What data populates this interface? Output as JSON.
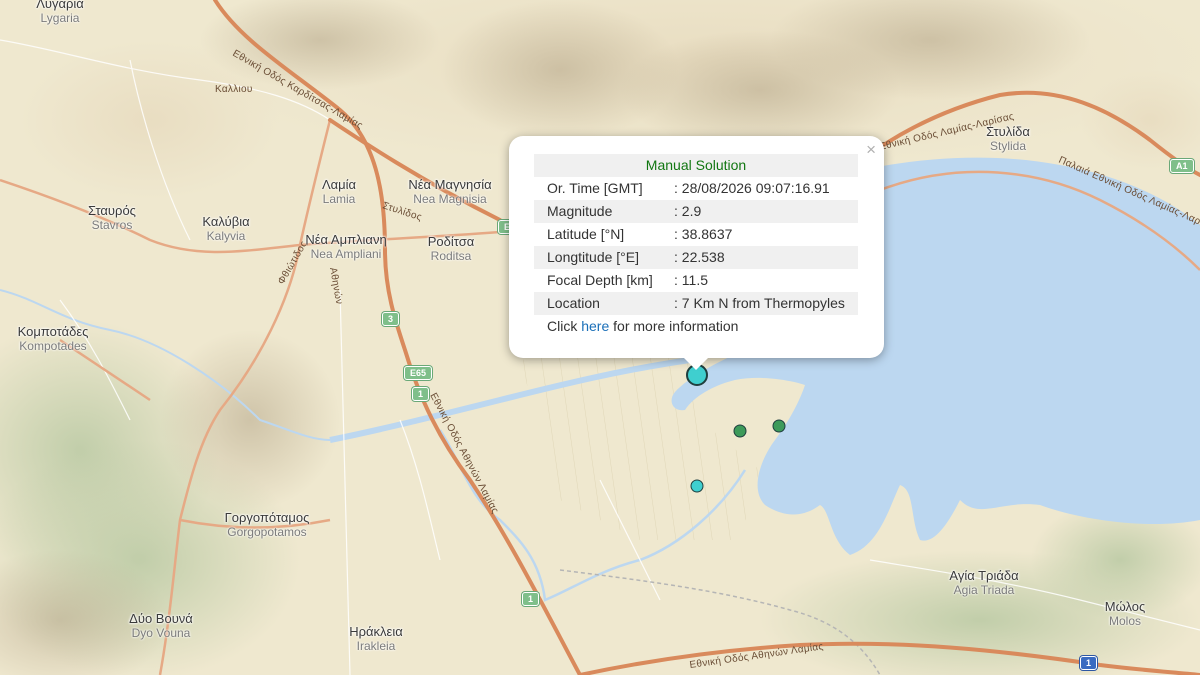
{
  "places": [
    {
      "id": "lygaria",
      "gr": "Λυγαριά",
      "lat": "Lygaria"
    },
    {
      "id": "stylida",
      "gr": "Στυλίδα",
      "lat": "Stylida"
    },
    {
      "id": "lamia",
      "gr": "Λαμία",
      "lat": "Lamia"
    },
    {
      "id": "nea-magnisia",
      "gr": "Νέα Μαγνησία",
      "lat": "Nea Magnisia"
    },
    {
      "id": "stavros",
      "gr": "Σταυρός",
      "lat": "Stavros"
    },
    {
      "id": "kalyvia",
      "gr": "Καλύβια",
      "lat": "Kalyvia"
    },
    {
      "id": "nea-ampliani",
      "gr": "Νέα Αμπλιανη",
      "lat": "Nea Ampliani"
    },
    {
      "id": "roditsa",
      "gr": "Ροδίτσα",
      "lat": "Roditsa"
    },
    {
      "id": "kompotades",
      "gr": "Κομποτάδες",
      "lat": "Kompotades"
    },
    {
      "id": "gorgopotamos",
      "gr": "Γοργοπόταμος",
      "lat": "Gorgopotamos"
    },
    {
      "id": "agia-triada",
      "gr": "Αγία Τριάδα",
      "lat": "Agia Triada"
    },
    {
      "id": "molos",
      "gr": "Μώλος",
      "lat": "Molos"
    },
    {
      "id": "dyo-vouna",
      "gr": "Δύο Βουνά",
      "lat": "Dyo Vouna"
    },
    {
      "id": "irakleia",
      "gr": "Ηράκλεια",
      "lat": "Irakleia"
    }
  ],
  "roads": {
    "lamia_karditsa": "Εθνική Οδός Καρδίτσας-Λαμίας",
    "lamia_larisa": "Εθνική Οδός Λαμίας-Λαρίσας",
    "old_lamia_larisa": "Παλαιά Εθνική Οδός Λαμίας-Λαρίσας",
    "athens_lamia": "Εθνική Οδός Αθηνών Λαμίας",
    "athens_lamia_south": "Εθνική Οδός Αθηνών Λαμίας",
    "kallios": "Καλλιου",
    "stylidos": "Στυλίδος",
    "fthiotidos": "Φθιώτιδος",
    "athinon": "Αθηνών"
  },
  "shields": {
    "a1_ne": "A1",
    "e65": "E65",
    "r1_a": "1",
    "r3": "3",
    "r1_b": "1",
    "r1_molos": "1",
    "e_mid": "E"
  },
  "colors": {
    "water": "#bcd7f0",
    "land": "#efe8cf",
    "motorway": "#d98a5c",
    "quake_recent": "#3fcfcf",
    "quake_older": "#3d9a5a"
  },
  "popup": {
    "title": "Manual Solution",
    "close_symbol": "×",
    "rows": [
      {
        "key": "Or. Time [GMT]",
        "value": ": 28/08/2026 09:07:16.91"
      },
      {
        "key": "Magnitude",
        "value": ": 2.9"
      },
      {
        "key": "Latitude [°N]",
        "value": ": 38.8637"
      },
      {
        "key": "Longtitude [°E]",
        "value": ": 22.538"
      },
      {
        "key": "Focal Depth [km]",
        "value": ": 11.5"
      },
      {
        "key": "Location",
        "value": ": 7 Km N from Thermopyles"
      }
    ],
    "more_prefix": "Click ",
    "more_link": "here",
    "more_suffix": " for more information"
  }
}
